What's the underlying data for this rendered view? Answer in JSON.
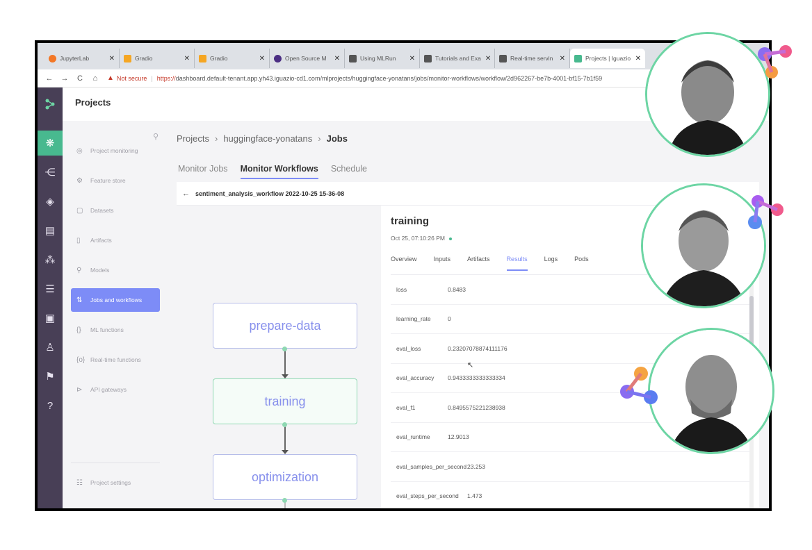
{
  "browser": {
    "tabs": [
      {
        "label": "JupyterLab",
        "color": "#f37726"
      },
      {
        "label": "Gradio",
        "color": "#f5a623"
      },
      {
        "label": "Gradio",
        "color": "#f5a623"
      },
      {
        "label": "Open Source M",
        "color": "#4b2e83"
      },
      {
        "label": "Using MLRun",
        "color": "#555555"
      },
      {
        "label": "Tutorials and Exa",
        "color": "#555555"
      },
      {
        "label": "Real-time servin",
        "color": "#555555"
      },
      {
        "label": "Projects | Iguazio",
        "color": "#48b98f"
      }
    ],
    "security_label": "Not secure",
    "url_scheme": "https://",
    "url_rest": "dashboard.default-tenant.app.yh43.iguazio-cd1.com/mlprojects/huggingface-yonatans/jobs/monitor-workflows/workflow/2d962267-be7b-4001-bf15-7b1f59"
  },
  "header": {
    "title": "Projects"
  },
  "menu": {
    "items": [
      {
        "label": "Project monitoring",
        "icon": "◎",
        "icon_name": "monitor-icon"
      },
      {
        "label": "Feature store",
        "icon": "⚙",
        "icon_name": "feature-store-icon"
      },
      {
        "label": "Datasets",
        "icon": "▢",
        "icon_name": "datasets-icon"
      },
      {
        "label": "Artifacts",
        "icon": "▯",
        "icon_name": "artifacts-icon"
      },
      {
        "label": "Models",
        "icon": "⚲",
        "icon_name": "models-icon"
      },
      {
        "label": "Jobs and workflows",
        "icon": "⇅",
        "icon_name": "jobs-icon"
      },
      {
        "label": "ML functions",
        "icon": "{}",
        "icon_name": "functions-icon"
      },
      {
        "label": "Real-time functions",
        "icon": "{o}",
        "icon_name": "realtime-icon"
      },
      {
        "label": "API gateways",
        "icon": "⊳",
        "icon_name": "api-gateway-icon"
      }
    ],
    "settings_label": "Project settings"
  },
  "breadcrumb": {
    "root": "Projects",
    "project": "huggingface-yonatans",
    "current": "Jobs"
  },
  "subtabs": [
    "Monitor Jobs",
    "Monitor Workflows",
    "Schedule"
  ],
  "workflow": {
    "title": "sentiment_analysis_workflow 2022-10-25 15-36-08"
  },
  "graph": {
    "nodes": [
      "prepare-data",
      "training",
      "optimization"
    ]
  },
  "details": {
    "title": "training",
    "date": "Oct 25, 07:10:26 PM",
    "tabs": [
      "Overview",
      "Inputs",
      "Artifacts",
      "Results",
      "Logs",
      "Pods"
    ],
    "active_tab": "Results",
    "results": [
      {
        "key": "loss",
        "value": "0.8483"
      },
      {
        "key": "learning_rate",
        "value": "0"
      },
      {
        "key": "eval_loss",
        "value": "0.23207078874111176"
      },
      {
        "key": "eval_accuracy",
        "value": "0.9433333333333334"
      },
      {
        "key": "eval_f1",
        "value": "0.8495575221238938"
      },
      {
        "key": "eval_runtime",
        "value": "12.9013"
      },
      {
        "key": "eval_samples_per_second",
        "value": "23.253"
      },
      {
        "key": "eval_steps_per_second",
        "value": "1.473"
      }
    ]
  },
  "colors": {
    "accent": "#7d8cf7",
    "nav": "#483f56",
    "success": "#48b98f",
    "avatar_ring": "#6dd5a4"
  }
}
